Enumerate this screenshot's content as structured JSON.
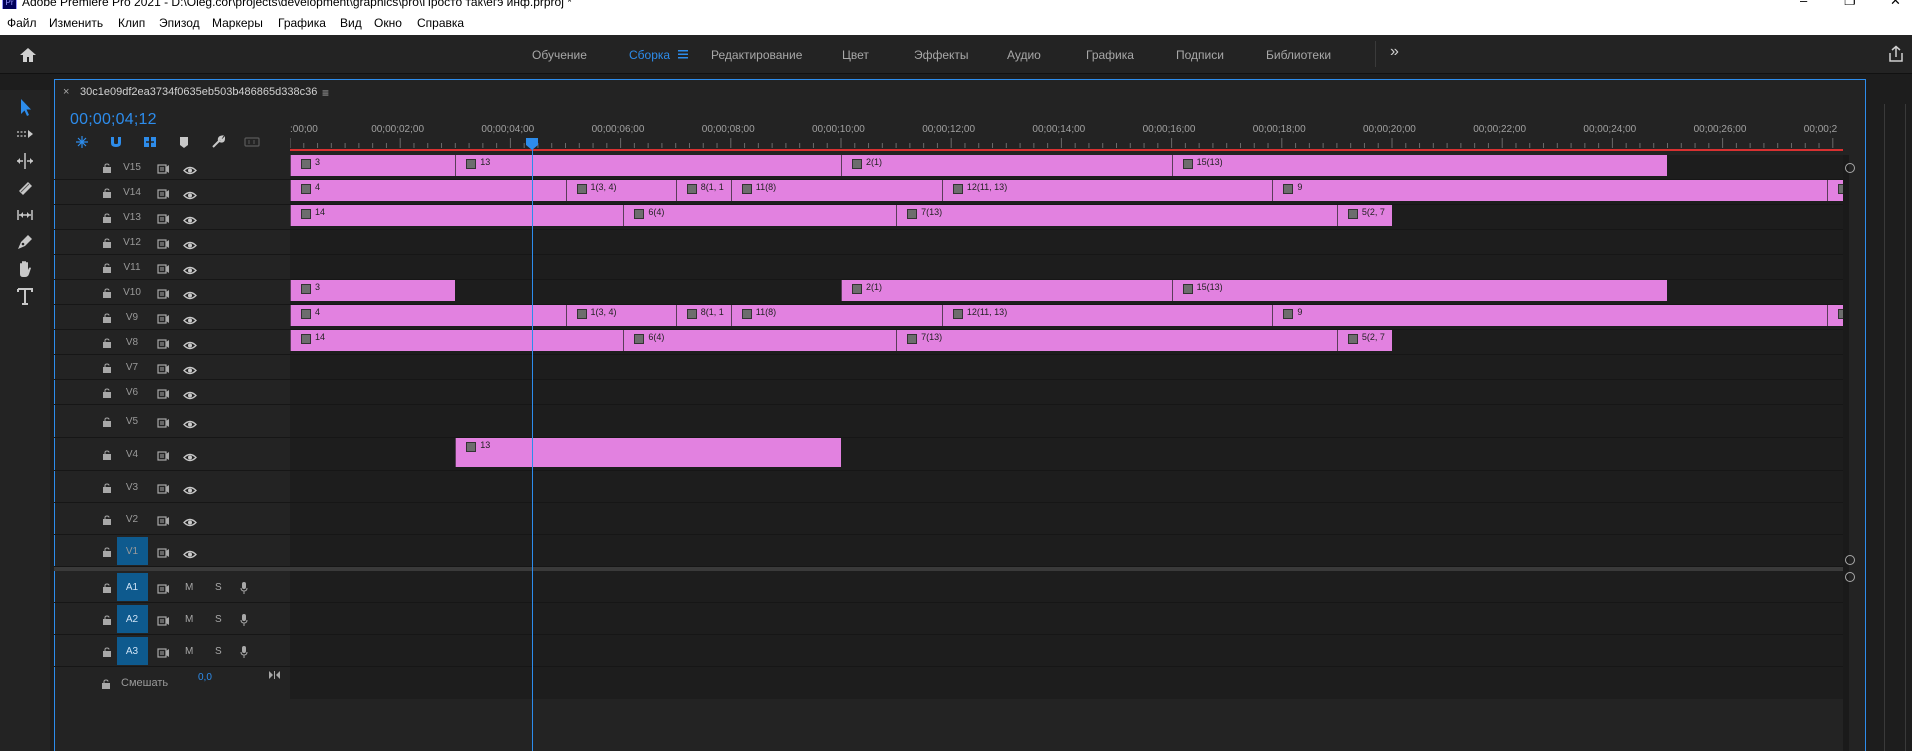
{
  "window": {
    "title": "Adobe Premiere Pro 2021 - D:\\Oleg.cor\\projects\\development\\graphics\\pro\\Просто так\\егэ инф.prproj *",
    "app_icon": "Pr"
  },
  "menu": [
    "Файл",
    "Изменить",
    "Клип",
    "Эпизод",
    "Маркеры",
    "Графика",
    "Вид",
    "Окно",
    "Справка"
  ],
  "workspaces": {
    "items": [
      "Обучение",
      "Сборка",
      "Редактирование",
      "Цвет",
      "Эффекты",
      "Аудио",
      "Графика",
      "Подписи",
      "Библиотеки"
    ],
    "active": "Сборка",
    "overflow": "»"
  },
  "sequence": {
    "tab_close": "×",
    "name": "30c1e09df2ea3734f0635eb503b486865d338c36",
    "menu_icon": "≡",
    "timecode": "00;00;04;12"
  },
  "ruler": {
    "labels": [
      ":00;00",
      "00;00;02;00",
      "00;00;04;00",
      "00;00;06;00",
      "00;00;08;00",
      "00;00;10;00",
      "00;00;12;00",
      "00;00;14;00",
      "00;00;16;00",
      "00;00;18;00",
      "00;00;20;00",
      "00;00;22;00",
      "00;00;24;00",
      "00;00;26;00",
      "00;00;2"
    ]
  },
  "video_tracks": [
    {
      "name": "V15",
      "clips": [
        {
          "label": "3",
          "start_s": 0.0,
          "end_s": 3.0
        },
        {
          "label": "13",
          "start_s": 3.0,
          "end_s": 10.0
        },
        {
          "label": "2(1)",
          "start_s": 10.0,
          "end_s": 16.0
        },
        {
          "label": "15(13)",
          "start_s": 16.0,
          "end_s": 25.0
        }
      ]
    },
    {
      "name": "V14",
      "clips": [
        {
          "label": "4",
          "start_s": 0.0,
          "end_s": 5.0
        },
        {
          "label": "1(3, 4)",
          "start_s": 5.0,
          "end_s": 7.0
        },
        {
          "label": "8(1, 1",
          "start_s": 7.0,
          "end_s": 8.0
        },
        {
          "label": "11(8)",
          "start_s": 8.0,
          "end_s": 11.83
        },
        {
          "label": "12(11, 13)",
          "start_s": 11.83,
          "end_s": 17.83
        },
        {
          "label": "9",
          "start_s": 17.83,
          "end_s": 27.9
        },
        {
          "label": "",
          "start_s": 27.9,
          "end_s": 28.2
        }
      ]
    },
    {
      "name": "V13",
      "clips": [
        {
          "label": "14",
          "start_s": 0.0,
          "end_s": 6.05
        },
        {
          "label": "6(4)",
          "start_s": 6.05,
          "end_s": 11.0
        },
        {
          "label": "7(13)",
          "start_s": 11.0,
          "end_s": 19.0
        },
        {
          "label": "5(2, 7",
          "start_s": 19.0,
          "end_s": 20.0
        }
      ]
    },
    {
      "name": "V12",
      "clips": []
    },
    {
      "name": "V11",
      "clips": []
    },
    {
      "name": "V10",
      "clips": [
        {
          "label": "3",
          "start_s": 0.0,
          "end_s": 3.0
        },
        {
          "label": "2(1)",
          "start_s": 10.0,
          "end_s": 16.0
        },
        {
          "label": "15(13)",
          "start_s": 16.0,
          "end_s": 25.0
        }
      ]
    },
    {
      "name": "V9",
      "clips": [
        {
          "label": "4",
          "start_s": 0.0,
          "end_s": 5.0
        },
        {
          "label": "1(3, 4)",
          "start_s": 5.0,
          "end_s": 7.0
        },
        {
          "label": "8(1, 1",
          "start_s": 7.0,
          "end_s": 8.0
        },
        {
          "label": "11(8)",
          "start_s": 8.0,
          "end_s": 11.83
        },
        {
          "label": "12(11, 13)",
          "start_s": 11.83,
          "end_s": 17.83
        },
        {
          "label": "9",
          "start_s": 17.83,
          "end_s": 27.9
        },
        {
          "label": "",
          "start_s": 27.9,
          "end_s": 28.2
        }
      ]
    },
    {
      "name": "V8",
      "clips": [
        {
          "label": "14",
          "start_s": 0.0,
          "end_s": 6.05
        },
        {
          "label": "6(4)",
          "start_s": 6.05,
          "end_s": 11.0
        },
        {
          "label": "7(13)",
          "start_s": 11.0,
          "end_s": 19.0
        },
        {
          "label": "5(2, 7",
          "start_s": 19.0,
          "end_s": 20.0
        }
      ]
    },
    {
      "name": "V7",
      "clips": []
    },
    {
      "name": "V6",
      "clips": []
    },
    {
      "name": "V5",
      "clips": []
    },
    {
      "name": "V4",
      "clips": [
        {
          "label": "13",
          "start_s": 3.0,
          "end_s": 10.0
        }
      ]
    },
    {
      "name": "V3",
      "clips": []
    },
    {
      "name": "V2",
      "clips": []
    },
    {
      "name": "V1",
      "clips": [],
      "patched": true
    }
  ],
  "audio_tracks": [
    {
      "name": "A1",
      "mute": "M",
      "solo": "S"
    },
    {
      "name": "A2",
      "mute": "M",
      "solo": "S"
    },
    {
      "name": "A3",
      "mute": "M",
      "solo": "S"
    }
  ],
  "mix": {
    "label": "Смешать",
    "value": "0,0"
  },
  "playhead_s": 4.4,
  "colors": {
    "accent": "#2d8ceb",
    "clip": "#e281e0",
    "track_patch": "#0e5a8e",
    "work_area": "#d83131"
  },
  "tools": [
    "selection-tool-icon",
    "track-select-tool-icon",
    "ripple-edit-tool-icon",
    "razor-tool-icon",
    "slip-tool-icon",
    "pen-tool-icon",
    "hand-tool-icon",
    "type-tool-icon"
  ]
}
